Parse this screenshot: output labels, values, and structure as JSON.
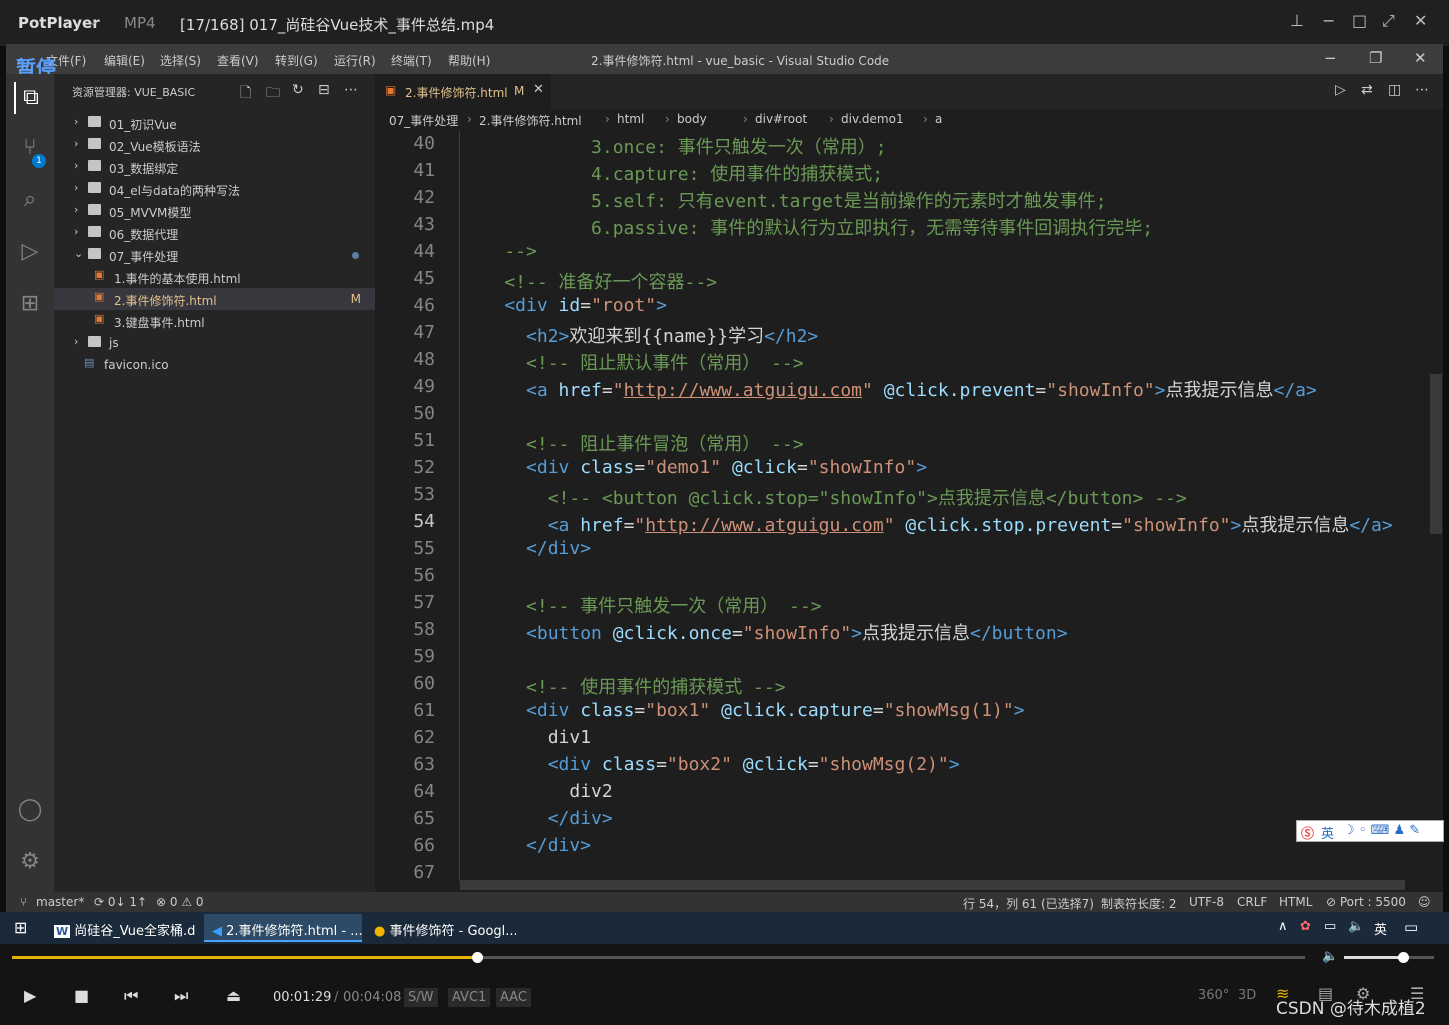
{
  "player": {
    "app_name": "PotPlayer",
    "format": "MP4",
    "file_title": "[17/168] 017_尚硅谷Vue技术_事件总结.mp4",
    "pause_label": "暂停"
  },
  "vscode": {
    "menu": [
      "文件(F)",
      "编辑(E)",
      "选择(S)",
      "查看(V)",
      "转到(G)",
      "运行(R)",
      "终端(T)",
      "帮助(H)"
    ],
    "window_title": "2.事件修饰符.html - vue_basic - Visual Studio Code",
    "explorer": {
      "header": "资源管理器: VUE_BASIC",
      "items": [
        {
          "label": "01_初识Vue",
          "type": "folder",
          "expanded": false
        },
        {
          "label": "02_Vue模板语法",
          "type": "folder",
          "expanded": false
        },
        {
          "label": "03_数据绑定",
          "type": "folder",
          "expanded": false
        },
        {
          "label": "04_el与data的两种写法",
          "type": "folder",
          "expanded": false
        },
        {
          "label": "05_MVVM模型",
          "type": "folder",
          "expanded": false
        },
        {
          "label": "06_数据代理",
          "type": "folder",
          "expanded": false
        },
        {
          "label": "07_事件处理",
          "type": "folder",
          "expanded": true
        },
        {
          "label": "1.事件的基本使用.html",
          "type": "html"
        },
        {
          "label": "2.事件修饰符.html",
          "type": "html",
          "selected": true,
          "badge": "M"
        },
        {
          "label": "3.键盘事件.html",
          "type": "html"
        },
        {
          "label": "js",
          "type": "folder",
          "expanded": false
        },
        {
          "label": "favicon.ico",
          "type": "ico"
        }
      ],
      "scm_badge": "1"
    },
    "tab": {
      "label": "2.事件修饰符.html",
      "modified": "M"
    },
    "breadcrumb": [
      "07_事件处理",
      "2.事件修饰符.html",
      "html",
      "body",
      "div#root",
      "div.demo1",
      "a"
    ],
    "code": [
      {
        "n": "40",
        "parts": [
          [
            "cm",
            "            3.once: 事件只触发一次（常用）;"
          ]
        ]
      },
      {
        "n": "41",
        "parts": [
          [
            "cm",
            "            4.capture: 使用事件的捕获模式;"
          ]
        ]
      },
      {
        "n": "42",
        "parts": [
          [
            "cm",
            "            5.self: 只有event.target是当前操作的元素时才触发事件;"
          ]
        ]
      },
      {
        "n": "43",
        "parts": [
          [
            "cm",
            "            6.passive: 事件的默认行为立即执行，无需等待事件回调执行完毕;"
          ]
        ]
      },
      {
        "n": "44",
        "parts": [
          [
            "cm",
            "    -->"
          ]
        ]
      },
      {
        "n": "45",
        "parts": [
          [
            "cm",
            "    <!-- 准备好一个容器-->"
          ]
        ]
      },
      {
        "n": "46",
        "parts": [
          [
            "tag",
            "    <div "
          ],
          [
            "attr",
            "id"
          ],
          [
            "txt",
            "="
          ],
          [
            "str",
            "\"root\""
          ],
          [
            "tag",
            ">"
          ]
        ]
      },
      {
        "n": "47",
        "parts": [
          [
            "tag",
            "      <h2>"
          ],
          [
            "txt",
            "欢迎来到{{name}}学习"
          ],
          [
            "tag",
            "</h2>"
          ]
        ]
      },
      {
        "n": "48",
        "parts": [
          [
            "cm",
            "      <!-- 阻止默认事件（常用） -->"
          ]
        ]
      },
      {
        "n": "49",
        "parts": [
          [
            "tag",
            "      <a "
          ],
          [
            "attr",
            "href"
          ],
          [
            "txt",
            "="
          ],
          [
            "str",
            "\""
          ],
          [
            "url",
            "http://www.atguigu.com"
          ],
          [
            "str",
            "\""
          ],
          [
            "attr",
            " @click.prevent"
          ],
          [
            "txt",
            "="
          ],
          [
            "str",
            "\"showInfo\""
          ],
          [
            "tag",
            ">"
          ],
          [
            "txt",
            "点我提示信息"
          ],
          [
            "tag",
            "</a>"
          ]
        ]
      },
      {
        "n": "50",
        "parts": [
          [
            "txt",
            ""
          ]
        ]
      },
      {
        "n": "51",
        "parts": [
          [
            "cm",
            "      <!-- 阻止事件冒泡（常用） -->"
          ]
        ]
      },
      {
        "n": "52",
        "parts": [
          [
            "tag",
            "      <div "
          ],
          [
            "attr",
            "class"
          ],
          [
            "txt",
            "="
          ],
          [
            "str",
            "\"demo1\""
          ],
          [
            "attr",
            " @click"
          ],
          [
            "txt",
            "="
          ],
          [
            "str",
            "\"showInfo\""
          ],
          [
            "tag",
            ">"
          ]
        ]
      },
      {
        "n": "53",
        "parts": [
          [
            "cm",
            "        <!-- <button @click.stop=\"showInfo\">点我提示信息</button> -->"
          ]
        ]
      },
      {
        "n": "54",
        "parts": [
          [
            "tag",
            "        <a "
          ],
          [
            "attr",
            "href"
          ],
          [
            "txt",
            "="
          ],
          [
            "str",
            "\""
          ],
          [
            "url",
            "http://www.atguigu.com"
          ],
          [
            "str",
            "\""
          ],
          [
            "attr",
            " @click.stop.prevent"
          ],
          [
            "txt",
            "="
          ],
          [
            "str",
            "\"showInfo\""
          ],
          [
            "tag",
            ">"
          ],
          [
            "txt",
            "点我提示信息"
          ],
          [
            "tag",
            "</a>"
          ]
        ]
      },
      {
        "n": "55",
        "parts": [
          [
            "tag",
            "      </div>"
          ]
        ]
      },
      {
        "n": "56",
        "parts": [
          [
            "txt",
            ""
          ]
        ]
      },
      {
        "n": "57",
        "parts": [
          [
            "cm",
            "      <!-- 事件只触发一次（常用） -->"
          ]
        ]
      },
      {
        "n": "58",
        "parts": [
          [
            "tag",
            "      <button "
          ],
          [
            "attr",
            "@click.once"
          ],
          [
            "txt",
            "="
          ],
          [
            "str",
            "\"showInfo\""
          ],
          [
            "tag",
            ">"
          ],
          [
            "txt",
            "点我提示信息"
          ],
          [
            "tag",
            "</button>"
          ]
        ]
      },
      {
        "n": "59",
        "parts": [
          [
            "txt",
            ""
          ]
        ]
      },
      {
        "n": "60",
        "parts": [
          [
            "cm",
            "      <!-- 使用事件的捕获模式 -->"
          ]
        ]
      },
      {
        "n": "61",
        "parts": [
          [
            "tag",
            "      <div "
          ],
          [
            "attr",
            "class"
          ],
          [
            "txt",
            "="
          ],
          [
            "str",
            "\"box1\""
          ],
          [
            "attr",
            " @click.capture"
          ],
          [
            "txt",
            "="
          ],
          [
            "str",
            "\"showMsg(1)\""
          ],
          [
            "tag",
            ">"
          ]
        ]
      },
      {
        "n": "62",
        "parts": [
          [
            "txt",
            "        div1"
          ]
        ]
      },
      {
        "n": "63",
        "parts": [
          [
            "tag",
            "        <div "
          ],
          [
            "attr",
            "class"
          ],
          [
            "txt",
            "="
          ],
          [
            "str",
            "\"box2\""
          ],
          [
            "attr",
            " @click"
          ],
          [
            "txt",
            "="
          ],
          [
            "str",
            "\"showMsg(2)\""
          ],
          [
            "tag",
            ">"
          ]
        ]
      },
      {
        "n": "64",
        "parts": [
          [
            "txt",
            "          div2"
          ]
        ]
      },
      {
        "n": "65",
        "parts": [
          [
            "tag",
            "        </div>"
          ]
        ]
      },
      {
        "n": "66",
        "parts": [
          [
            "tag",
            "      </div>"
          ]
        ]
      },
      {
        "n": "67",
        "parts": [
          [
            "txt",
            ""
          ]
        ]
      }
    ],
    "current_line": "54",
    "status": {
      "branch": "master*",
      "sync": "0↓ 1↑",
      "problems": "⊗ 0 ⚠ 0",
      "position": "行 54，列 61 (已选择7)",
      "tab_size": "制表符长度: 2",
      "encoding": "UTF-8",
      "eol": "CRLF",
      "language": "HTML",
      "port": "Port : 5500"
    }
  },
  "taskbar": {
    "items": [
      "尚硅谷_Vue全家桶.d...",
      "2.事件修饰符.html - ...",
      "事件修饰符 - Googl..."
    ],
    "ime": "英"
  },
  "playback": {
    "current_time": "00:01:29",
    "duration": "00:04:08",
    "tags": [
      "S/W",
      "AVC1",
      "AAC"
    ],
    "progress": 0.36,
    "volume": 0.65,
    "watermark": "CSDN @待木成植2"
  },
  "colors": {
    "accent": "#007acc",
    "seek": "#e5b400"
  }
}
